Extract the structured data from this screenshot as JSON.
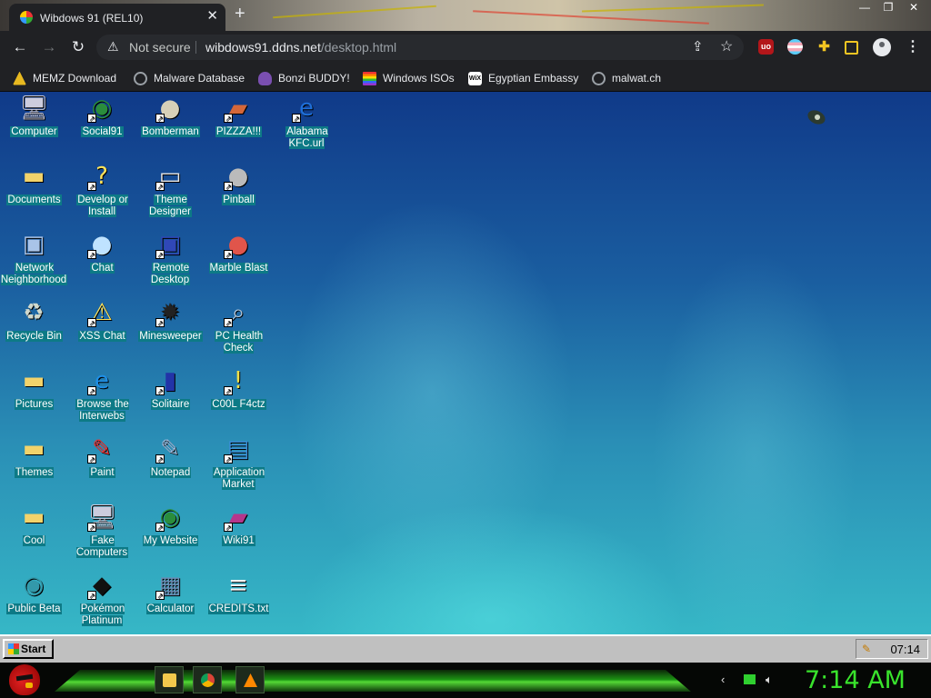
{
  "browser": {
    "tab": {
      "title": "Wibdows 91 (REL10)",
      "close_glyph": "✕"
    },
    "new_tab_glyph": "+",
    "window_controls": {
      "minimize": "—",
      "maximize": "❐",
      "close": "✕"
    },
    "nav": {
      "back": "←",
      "forward": "→",
      "reload": "↻"
    },
    "address": {
      "security_text": "Not secure",
      "warning_glyph": "⚠",
      "host": "wibdows91.ddns.net",
      "path": "/desktop.html"
    },
    "toolbar_icons": [
      "share-icon",
      "star-icon",
      "ublock-icon",
      "flag-extension-icon",
      "puzzle-extensions-icon",
      "sidepanel-icon",
      "profile-icon",
      "menu-icon"
    ],
    "bookmarks": [
      {
        "label": "MEMZ Download",
        "icon": "yellow-triangle",
        "color": "#e8b920"
      },
      {
        "label": "Malware Database",
        "icon": "globe",
        "color": "#9aa0a6"
      },
      {
        "label": "Bonzi BUDDY!",
        "icon": "bonzi",
        "color": "#b58a2e"
      },
      {
        "label": "Windows ISOs",
        "icon": "rainbow",
        "color": "#e33"
      },
      {
        "label": "Egyptian Embassy",
        "icon": "wix",
        "color": "#ffffff"
      },
      {
        "label": "malwat.ch",
        "icon": "globe",
        "color": "#9aa0a6"
      }
    ]
  },
  "desktop": {
    "icons": [
      {
        "label": "Computer",
        "icon": "computer-icon",
        "col": 0,
        "row": 0,
        "shortcut": false
      },
      {
        "label": "Social91",
        "icon": "globe-icon",
        "col": 1,
        "row": 0,
        "shortcut": true
      },
      {
        "label": "Bomberman",
        "icon": "bomberman-icon",
        "col": 2,
        "row": 0,
        "shortcut": true
      },
      {
        "label": "PIZZZA!!!",
        "icon": "pizza-icon",
        "col": 3,
        "row": 0,
        "shortcut": true
      },
      {
        "label": "Alabama KFC.url",
        "icon": "ie-document-icon",
        "col": 4,
        "row": 0,
        "shortcut": true
      },
      {
        "label": "Documents",
        "icon": "folder-docs-icon",
        "col": 0,
        "row": 1,
        "shortcut": false
      },
      {
        "label": "Develop or Install",
        "icon": "help-icon",
        "col": 1,
        "row": 1,
        "shortcut": true
      },
      {
        "label": "Theme Designer",
        "icon": "window-icon",
        "col": 2,
        "row": 1,
        "shortcut": true
      },
      {
        "label": "Pinball",
        "icon": "pinball-icon",
        "col": 3,
        "row": 1,
        "shortcut": true
      },
      {
        "label": "Network Neighborhood",
        "icon": "network-icon",
        "col": 0,
        "row": 2,
        "shortcut": false
      },
      {
        "label": "Chat",
        "icon": "chat-bubble-icon",
        "col": 1,
        "row": 2,
        "shortcut": true
      },
      {
        "label": "Remote Desktop",
        "icon": "remote-desktop-icon",
        "col": 2,
        "row": 2,
        "shortcut": true
      },
      {
        "label": "Marble Blast",
        "icon": "marble-icon",
        "col": 3,
        "row": 2,
        "shortcut": true
      },
      {
        "label": "Recycle Bin",
        "icon": "recycle-bin-icon",
        "col": 0,
        "row": 3,
        "shortcut": false
      },
      {
        "label": "XSS Chat",
        "icon": "chat-warning-icon",
        "col": 1,
        "row": 3,
        "shortcut": true
      },
      {
        "label": "Minesweeper",
        "icon": "mine-icon",
        "col": 2,
        "row": 3,
        "shortcut": true
      },
      {
        "label": "PC Health Check",
        "icon": "health-check-icon",
        "col": 3,
        "row": 3,
        "shortcut": true
      },
      {
        "label": "Pictures",
        "icon": "folder-icon",
        "col": 0,
        "row": 4,
        "shortcut": false
      },
      {
        "label": "Browse the Interwebs",
        "icon": "ie-icon",
        "col": 1,
        "row": 4,
        "shortcut": true
      },
      {
        "label": "Solitaire",
        "icon": "cards-icon",
        "col": 2,
        "row": 4,
        "shortcut": true
      },
      {
        "label": "C00L F4ctz",
        "icon": "lightbulb-icon",
        "col": 3,
        "row": 4,
        "shortcut": true
      },
      {
        "label": "Themes",
        "icon": "folder-icon",
        "col": 0,
        "row": 5,
        "shortcut": false
      },
      {
        "label": "Paint",
        "icon": "paint-icon",
        "col": 1,
        "row": 5,
        "shortcut": true
      },
      {
        "label": "Notepad",
        "icon": "notepad-icon",
        "col": 2,
        "row": 5,
        "shortcut": true
      },
      {
        "label": "Application Market",
        "icon": "shopping-bag-icon",
        "col": 3,
        "row": 5,
        "shortcut": true
      },
      {
        "label": "Cool",
        "icon": "folder-icon",
        "col": 0,
        "row": 6,
        "shortcut": false
      },
      {
        "label": "Fake Computers",
        "icon": "computer-icon",
        "col": 1,
        "row": 6,
        "shortcut": true
      },
      {
        "label": "My Website",
        "icon": "globe-icon",
        "col": 2,
        "row": 6,
        "shortcut": true
      },
      {
        "label": "Wiki91",
        "icon": "book-icon",
        "col": 3,
        "row": 6,
        "shortcut": true
      },
      {
        "label": "Public Beta",
        "icon": "globe-colorful-icon",
        "col": 0,
        "row": 7,
        "shortcut": false
      },
      {
        "label": "Pokémon Platinum",
        "icon": "pokemon-icon",
        "col": 1,
        "row": 7,
        "shortcut": true
      },
      {
        "label": "Calculator",
        "icon": "calculator-icon",
        "col": 2,
        "row": 7,
        "shortcut": true
      },
      {
        "label": "CREDITS.txt",
        "icon": "text-file-icon",
        "col": 3,
        "row": 7,
        "shortcut": false
      }
    ]
  },
  "taskbar95": {
    "start_label": "Start",
    "tray_time": "07:14",
    "tray_icon": "pencil-icon"
  },
  "host_taskbar": {
    "pinned": [
      "file-explorer-icon",
      "chrome-icon",
      "vlc-icon"
    ],
    "tray_icons": [
      "chevron-icon",
      "network-icon",
      "volume-icon"
    ],
    "clock": "7:14 AM",
    "clock_color": "#39e32c"
  },
  "colors": {
    "label_highlight": "#0d7a86",
    "win95_gray": "#c0c0c0",
    "chrome_dark": "#202124"
  }
}
